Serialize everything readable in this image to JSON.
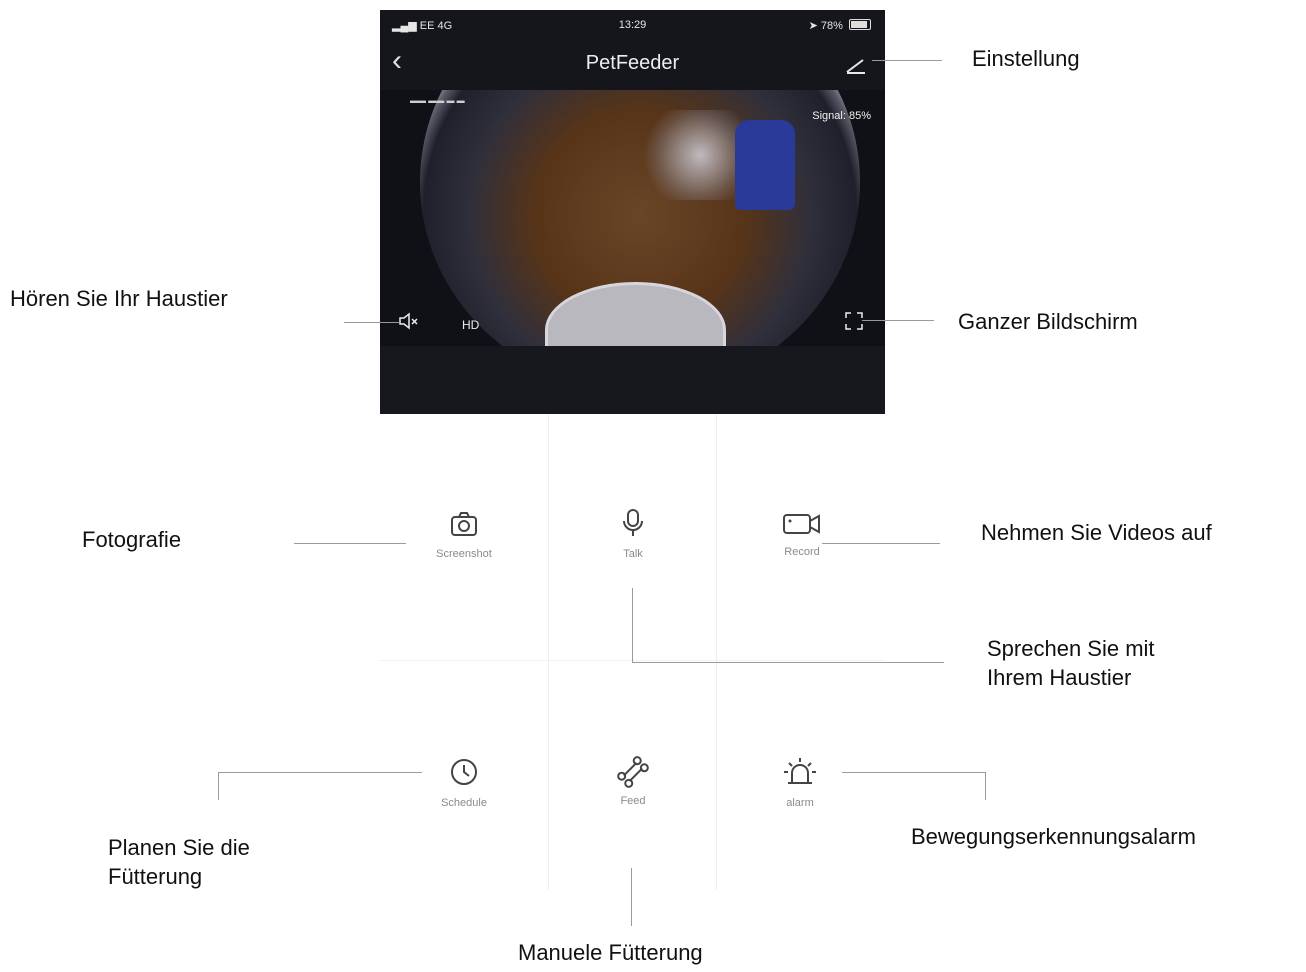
{
  "statusbar": {
    "carrier": "EE 4G",
    "time": "13:29",
    "battery_percent": "78%",
    "battery_level": 0.78
  },
  "header": {
    "title": "PetFeeder",
    "back_icon": "chevron-left-icon",
    "settings_icon": "pencil-icon"
  },
  "camera": {
    "signal": "Signal: 85%",
    "hd_label": "HD",
    "mute_icon": "speaker-muted-icon",
    "fullscreen_icon": "fullscreen-icon"
  },
  "controls": {
    "screenshot": "Screenshot",
    "talk": "Talk",
    "record": "Record",
    "schedule": "Schedule",
    "feed": "Feed",
    "alarm": "alarm"
  },
  "callouts": {
    "settings": "Einstellung",
    "listen": "Hören Sie Ihr Haustier",
    "fullscreen": "Ganzer Bildschirm",
    "photo": "Fotografie",
    "record": "Nehmen Sie Videos auf",
    "talk_line1": "Sprechen Sie mit",
    "talk_line2": "Ihrem Haustier",
    "schedule_line1": "Planen Sie die",
    "schedule_line2": "Fütterung",
    "alarm": "Bewegungserkennungsalarm",
    "feed": "Manuele Fütterung"
  }
}
